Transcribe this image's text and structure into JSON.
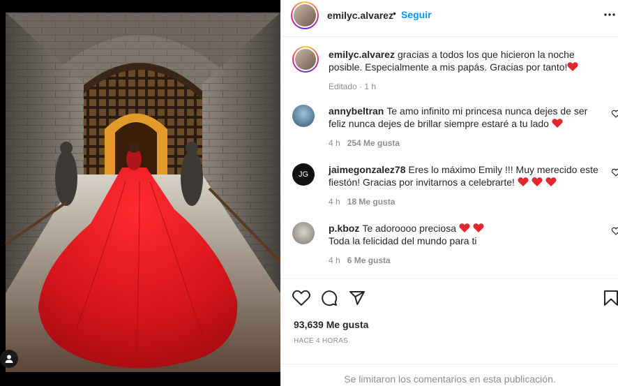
{
  "post": {
    "author": "emilyc.alvarez",
    "dot": "•",
    "follow_label": "Seguir",
    "caption_text": "gracias a todos los que hicieron la noche posible. Especialmente a mis papás. Gracias por tanto!",
    "caption_meta": "Editado · 1 h"
  },
  "comments": [
    {
      "user": "annybeltran",
      "text": "Te amo infinito mi princesa nunca dejes de ser feliz nunca dejes de brillar siempre estaré a tu lado",
      "hearts": 1,
      "time": "4 h",
      "likes": "254 Me gusta"
    },
    {
      "user": "jaimegonzalez78",
      "text": "Eres lo máximo Emily !!! Muy merecido este fiestón! Gracias por invitarnos a celebrarte!",
      "hearts": 3,
      "time": "4 h",
      "likes": "18 Me gusta",
      "avatar_initials": "JG"
    },
    {
      "user": "p.kboz",
      "text": "Te adoroooo preciosa",
      "text2": "Toda la felicidad del mundo para ti",
      "hearts": 2,
      "time": "4 h",
      "likes": "6 Me gusta"
    }
  ],
  "footer": {
    "likes": "93,639 Me gusta",
    "time": "HACE 4 HORAS",
    "limited": "Se limitaron los comentarios en esta publicación."
  },
  "icons": {
    "like": "heart-icon",
    "comment": "comment-icon",
    "share": "share-icon",
    "save": "bookmark-icon",
    "more": "more-icon",
    "user_tag": "user-icon"
  },
  "colors": {
    "accent": "#0095f6",
    "heart": "#e0262f",
    "muted": "#8e8e8e",
    "dress": "#d5141b"
  }
}
